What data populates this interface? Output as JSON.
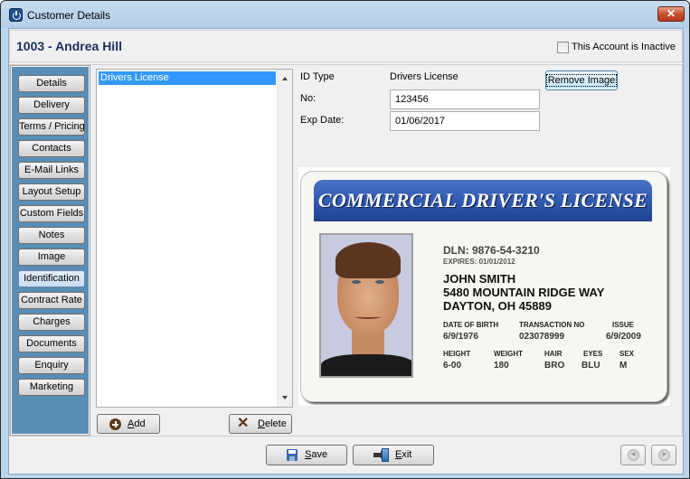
{
  "window": {
    "title": "Customer Details",
    "close_label": "✕"
  },
  "header": {
    "customer_title": "1003 - Andrea Hill",
    "inactive_checkbox": {
      "label": "This Account is Inactive",
      "checked": false
    }
  },
  "sidebar": {
    "items": [
      {
        "label": "Details",
        "active": false
      },
      {
        "label": "Delivery",
        "active": false
      },
      {
        "label": "Terms / Pricing",
        "active": false
      },
      {
        "label": "Contacts",
        "active": false
      },
      {
        "label": "E-Mail Links",
        "active": false
      },
      {
        "label": "Layout Setup",
        "active": false
      },
      {
        "label": "Custom Fields",
        "active": false
      },
      {
        "label": "Notes",
        "active": false
      },
      {
        "label": "Image",
        "active": false
      },
      {
        "label": "Identification",
        "active": true
      },
      {
        "label": "Contract Rate",
        "active": false
      },
      {
        "label": "Charges",
        "active": false
      },
      {
        "label": "Documents",
        "active": false
      },
      {
        "label": "Enquiry",
        "active": false
      },
      {
        "label": "Marketing",
        "active": false
      }
    ]
  },
  "id_list": {
    "items": [
      "Drivers License"
    ],
    "selected": "Drivers License",
    "add_label": "Add",
    "add_underline": "A",
    "add_rest": "dd",
    "delete_label": "Delete",
    "delete_underline": "D",
    "delete_rest": "elete"
  },
  "details": {
    "id_type_label": "ID Type",
    "id_type_value": "Drivers License",
    "no_label": "No:",
    "no_value": "123456",
    "exp_label": "Exp Date:",
    "exp_value": "01/06/2017",
    "remove_image_label": "Remove Image"
  },
  "license_image": {
    "header": "COMMERCIAL DRIVER'S LICENSE",
    "dln": "DLN: 9876-54-3210",
    "expires": "EXPIRES: 01/01/2012",
    "name": "JOHN SMITH",
    "address1": "5480 MOUNTAIN RIDGE WAY",
    "address2": "DAYTON, OH 45889",
    "dob_label": "DATE OF BIRTH",
    "dob_value": "6/9/1976",
    "transaction_label": "TRANSACTION NO",
    "transaction_value": "023078999",
    "issue_label": "ISSUE",
    "issue_value": "6/9/2009",
    "height_label": "HEIGHT",
    "height_value": "6-00",
    "weight_label": "WEIGHT",
    "weight_value": "180",
    "hair_label": "HAIR",
    "hair_value": "BRO",
    "eyes_label": "EYES",
    "eyes_value": "BLU",
    "sex_label": "SEX",
    "sex_value": "M"
  },
  "footer": {
    "save_underline": "S",
    "save_rest": "ave",
    "exit_underline": "E",
    "exit_rest": "xit",
    "prev_icon": "◀|",
    "next_icon": "|▶"
  }
}
